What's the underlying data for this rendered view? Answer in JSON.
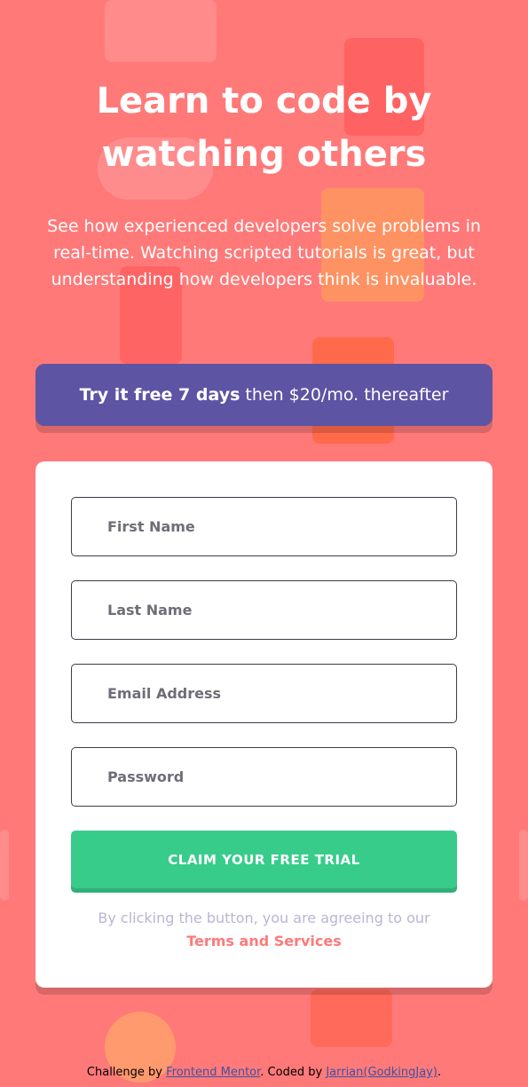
{
  "hero": {
    "title": "Learn to code by watching others",
    "description": "See how experienced developers solve problems in real-time. Watching scripted tutorials is great, but understanding how developers think is invaluable."
  },
  "offer": {
    "bold": "Try it free 7 days",
    "rest": "then $20/mo. thereafter"
  },
  "form": {
    "first_name_placeholder": "First Name",
    "last_name_placeholder": "Last Name",
    "email_placeholder": "Email Address",
    "password_placeholder": "Password",
    "submit_label": "CLAIM YOUR FREE TRIAL",
    "terms_prefix": "By clicking the button, you are agreeing to our",
    "terms_link": "Terms and Services"
  },
  "footer": {
    "prefix": "Challenge by",
    "link1": "Frontend Mentor",
    "middle": ". Coded by",
    "link2": "Jarrian(GodkingJay)",
    "suffix": "."
  },
  "colors": {
    "background": "#ff7979",
    "offer_bg": "#5e54a4",
    "submit_bg": "#38cc8b",
    "accent": "#ff7979",
    "muted": "#b9b6d3"
  }
}
